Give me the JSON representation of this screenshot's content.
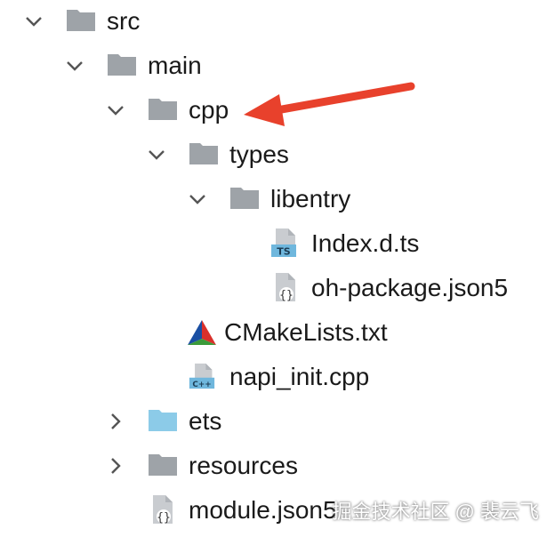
{
  "tree": {
    "src": "src",
    "main": "main",
    "cpp": "cpp",
    "types": "types",
    "libentry": "libentry",
    "index_d_ts": "Index.d.ts",
    "oh_package_json5": "oh-package.json5",
    "cmakelists": "CMakeLists.txt",
    "napi_init": "napi_init.cpp",
    "ets": "ets",
    "resources": "resources",
    "module_json5": "module.json5"
  },
  "icons": {
    "ts_badge": "TS",
    "cpp_badge": "C++",
    "json_badge": "{}"
  },
  "watermark": "掘金技术社区 @ 裴云飞",
  "colors": {
    "folder_gray": "#9ea3a8",
    "folder_blue": "#8ccbe8",
    "arrow_red": "#e8412c",
    "text": "#1a1a1a"
  }
}
